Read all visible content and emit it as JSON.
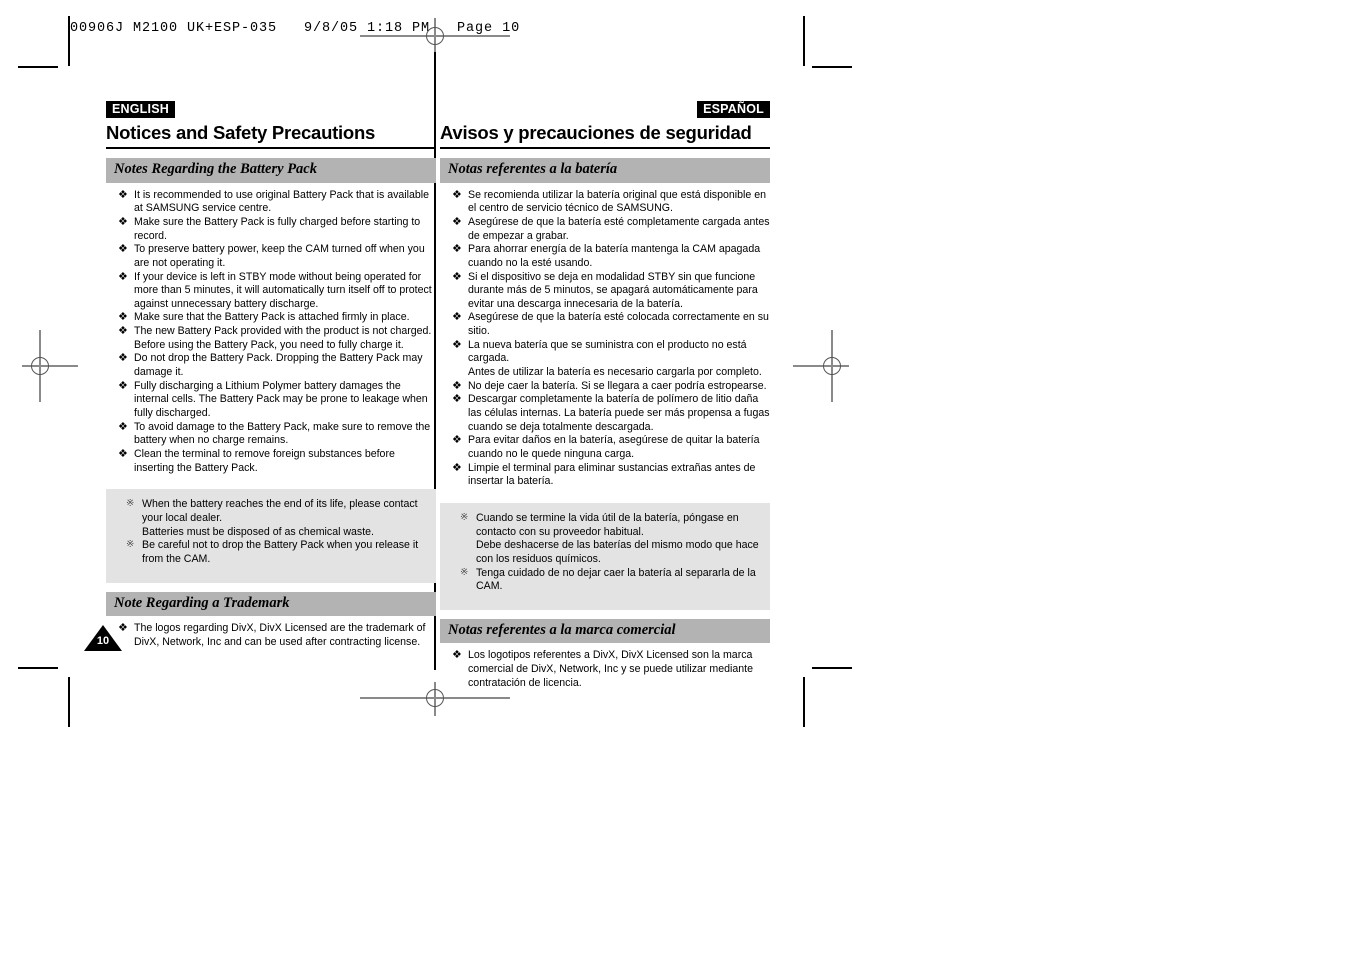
{
  "prepress": {
    "slug": "00906J M2100 UK+ESP-035   9/8/05 1:18 PM   Page 10"
  },
  "page_number": "10",
  "columns": {
    "english": {
      "lang_tag": "ENGLISH",
      "title": "Notices and Safety Precautions",
      "sections": [
        {
          "heading": "Notes Regarding the Battery Pack",
          "bullets": [
            "It is recommended to use original Battery Pack that is available at SAMSUNG service centre.",
            "Make sure the Battery Pack is fully charged before starting to record.",
            "To preserve battery power, keep the CAM turned off when you are not operating it.",
            "If your device is left in STBY mode without being operated for more than 5 minutes, it will automatically turn itself off to protect against unnecessary battery discharge.",
            "Make sure that the Battery Pack is attached firmly in place.",
            "The new Battery Pack provided with the product is not charged. Before using the Battery Pack, you need to fully charge it.",
            "Do not drop the Battery Pack. Dropping the Battery Pack may damage it.",
            "Fully discharging a Lithium Polymer battery damages the internal cells. The Battery Pack may be prone to leakage when fully discharged.",
            "To avoid damage to the Battery Pack, make sure to remove the battery when no charge remains.",
            "Clean the terminal to remove foreign substances before inserting the Battery Pack."
          ]
        }
      ],
      "note_box": [
        {
          "text": "When the battery reaches the end of its life, please contact your local dealer.",
          "continuation": "Batteries must be disposed of as chemical waste."
        },
        {
          "text": "Be careful not to drop the Battery Pack when you release it from the CAM.",
          "continuation": ""
        }
      ],
      "trademark": {
        "heading": "Note Regarding a Trademark",
        "bullets": [
          "The logos regarding DivX, DivX Licensed are the trademark of DivX, Network, Inc and can be used after contracting license."
        ]
      }
    },
    "spanish": {
      "lang_tag": "ESPAÑOL",
      "title": "Avisos y precauciones de seguridad",
      "sections": [
        {
          "heading": "Notas referentes a la batería",
          "bullets": [
            "Se recomienda utilizar la batería original que está disponible en el centro de servicio técnico de SAMSUNG.",
            "Asegúrese de que la batería esté completamente cargada antes de empezar a grabar.",
            "Para ahorrar energía de la batería mantenga la CAM apagada cuando no la esté usando.",
            "Si el dispositivo se deja en modalidad STBY sin que funcione durante más de 5 minutos, se apagará automáticamente para evitar una descarga innecesaria de la batería.",
            "Asegúrese de que la batería esté colocada correctamente en su sitio.",
            "La nueva batería que se suministra con el producto no está cargada.",
            "No deje caer la batería. Si se llegara a caer podría estropearse.",
            "Descargar completamente la batería de polímero de litio daña las células internas. La batería puede ser más propensa a fugas cuando se deja totalmente descargada.",
            "Para evitar daños en la batería, asegúrese de quitar la batería cuando no le quede ninguna carga.",
            "Limpie el terminal para eliminar sustancias extrañas antes de insertar la batería."
          ],
          "bullet_continuations": {
            "5": "Antes de utilizar la batería es necesario cargarla por completo."
          }
        }
      ],
      "note_box": [
        {
          "text": "Cuando se termine la vida útil de la batería, póngase en contacto con su proveedor habitual.",
          "continuation": "Debe deshacerse de las baterías del mismo modo que hace con los residuos químicos."
        },
        {
          "text": "Tenga cuidado de no dejar caer la batería al separarla de la CAM.",
          "continuation": ""
        }
      ],
      "trademark": {
        "heading": "Notas referentes a la marca comercial",
        "bullets": [
          "Los logotipos referentes a DivX, DivX Licensed son la marca comercial de DivX, Network, Inc y se puede utilizar mediante contratación de licencia."
        ]
      }
    }
  },
  "glyphs": {
    "bullet": "❖",
    "note_bullet": "※"
  },
  "colors": {
    "section_bar": "#b3b3b3",
    "note_box": "#e3e3e3",
    "text": "#000000",
    "tag_bg": "#000000"
  }
}
